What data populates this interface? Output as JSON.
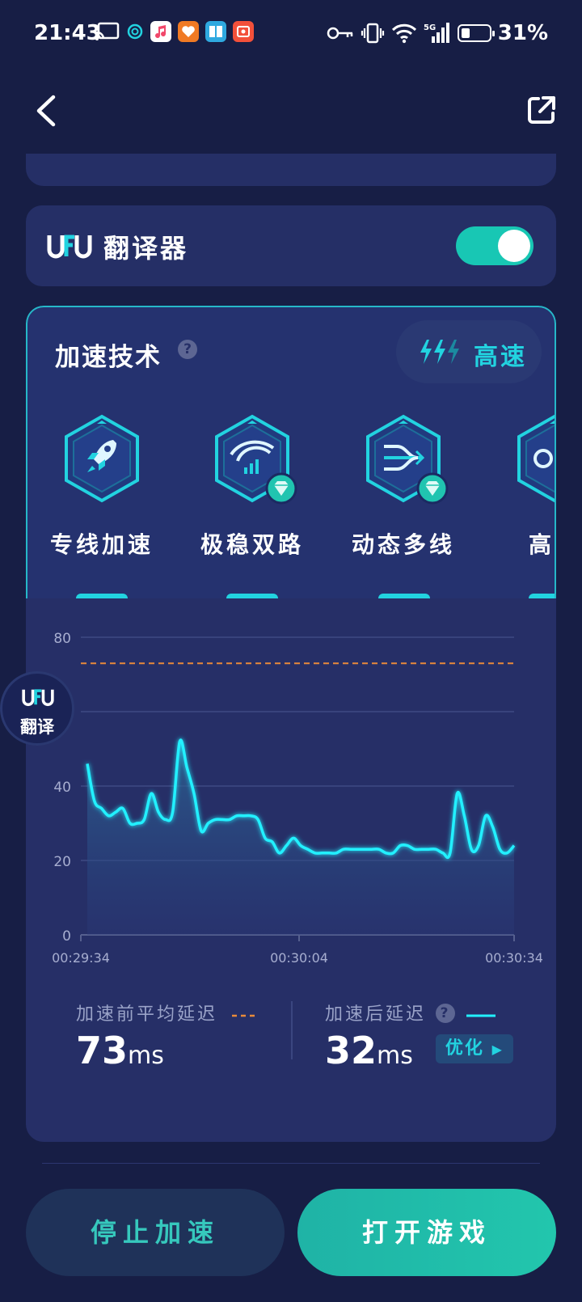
{
  "status_bar": {
    "time": "21:43",
    "battery_text": "31%",
    "battery_level": 0.31,
    "signal_label": "5G",
    "left_icons": [
      "cast-icon",
      "vpn-icon",
      "music-app-icon",
      "health-app-icon",
      "reader-app-icon",
      "video-app-icon"
    ],
    "right_icons": [
      "key-icon",
      "vibrate-icon",
      "wifi-icon",
      "cellular-signal-icon",
      "battery-icon"
    ]
  },
  "nav": {
    "back_icon": "chevron-left-icon",
    "share_icon": "external-link-icon"
  },
  "translator": {
    "logo_text": "UFU",
    "title": "翻译器",
    "enabled": true
  },
  "accel": {
    "title": "加速技术",
    "speed_label": "高速",
    "techniques": [
      {
        "label": "专线加速",
        "icon": "rocket-icon",
        "premium": false
      },
      {
        "label": "极稳双路",
        "icon": "dual-route-wifi-icon",
        "premium": true
      },
      {
        "label": "动态多线",
        "icon": "multi-line-icon",
        "premium": true
      },
      {
        "label": "高速",
        "icon": "speed-icon",
        "premium": false
      }
    ]
  },
  "chart_data": {
    "type": "line",
    "y_ticks": [
      "0",
      "20",
      "40",
      "80"
    ],
    "x_ticks": [
      "00:29:34",
      "00:30:04",
      "00:30:34"
    ],
    "ylim": [
      0,
      80
    ],
    "grid": true,
    "reference_line": {
      "value": 73,
      "style": "dashed",
      "color": "#e88a3a"
    },
    "series": [
      {
        "color": "#22f0ff",
        "x": [
          0,
          1,
          2,
          3,
          4,
          5,
          6,
          7,
          8,
          9,
          10,
          11,
          12,
          13,
          14,
          15,
          16,
          17,
          18,
          19,
          20,
          21,
          22,
          23,
          24,
          25,
          26,
          27,
          28,
          29,
          30,
          31,
          32,
          33,
          34,
          35,
          36,
          37,
          38,
          39,
          40,
          41,
          42,
          43,
          44,
          45,
          46,
          47,
          48,
          49,
          50,
          51,
          52,
          53,
          54,
          55,
          56,
          57,
          58,
          59,
          60
        ],
        "values": [
          46,
          36,
          34,
          32,
          33,
          34,
          30,
          30,
          31,
          38,
          33,
          31,
          33,
          52,
          45,
          38,
          28,
          30,
          31,
          31,
          31,
          32,
          32,
          32,
          31,
          26,
          25,
          22,
          24,
          26,
          24,
          23,
          22,
          22,
          22,
          22,
          23,
          23,
          23,
          23,
          23,
          23,
          22,
          22,
          24,
          24,
          23,
          23,
          23,
          23,
          22,
          22,
          38,
          32,
          23,
          24,
          32,
          29,
          23,
          22,
          24
        ]
      }
    ]
  },
  "metrics": {
    "before_label": "加速前平均延迟",
    "before_value": "73",
    "after_label": "加速后延迟",
    "after_value": "32",
    "unit": "ms",
    "optimize_label": "优化"
  },
  "floating_badge": {
    "logo_text": "UFU",
    "label": "翻译"
  },
  "buttons": {
    "stop": "停止加速",
    "open": "打开游戏"
  },
  "colors": {
    "accent": "#22d3e0",
    "toggle_on": "#18c7b4",
    "card": "#262f67",
    "background": "#171e45"
  }
}
